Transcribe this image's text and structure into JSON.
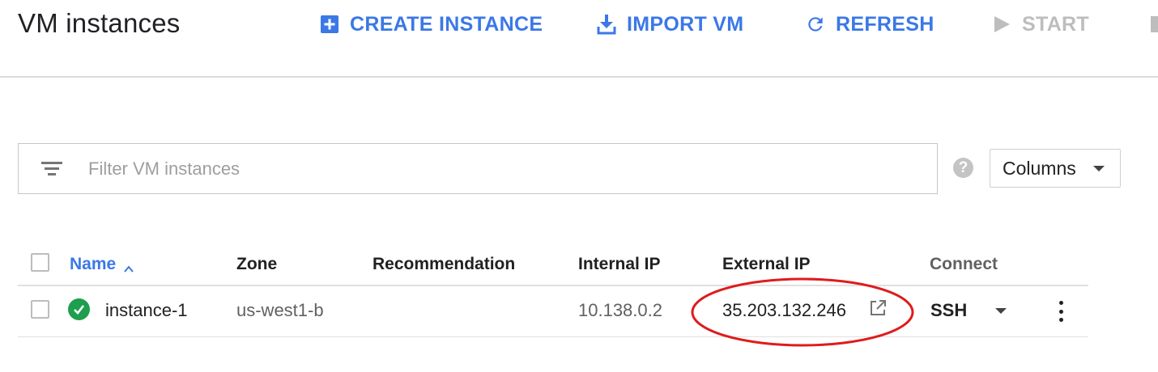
{
  "header": {
    "title": "VM instances",
    "actions": [
      {
        "label": "CREATE INSTANCE",
        "icon": "add-box-icon",
        "enabled": true
      },
      {
        "label": "IMPORT VM",
        "icon": "download-icon",
        "enabled": true
      },
      {
        "label": "REFRESH",
        "icon": "refresh-icon",
        "enabled": true
      },
      {
        "label": "START",
        "icon": "play-icon",
        "enabled": false
      }
    ]
  },
  "filter": {
    "placeholder": "Filter VM instances",
    "value": "",
    "icon": "filter-list-icon"
  },
  "help": {
    "icon": "help-icon",
    "glyph": "?"
  },
  "columns_button": {
    "label": "Columns",
    "icon": "arrow-drop-down-icon"
  },
  "table": {
    "headers": {
      "name": "Name",
      "zone": "Zone",
      "recommendation": "Recommendation",
      "internal_ip": "Internal IP",
      "external_ip": "External IP",
      "connect": "Connect"
    },
    "sort": {
      "column": "Name",
      "direction": "ascending"
    },
    "rows": [
      {
        "status": "running",
        "name": "instance-1",
        "zone": "us-west1-b",
        "recommendation": "",
        "internal_ip": "10.138.0.2",
        "external_ip": "35.203.132.246",
        "connect": "SSH"
      }
    ]
  },
  "colors": {
    "accent_blue": "#3b78e7",
    "status_green": "#1e9e4f",
    "annotation_red": "#e01b1b",
    "disabled_grey": "#bdbdbd"
  }
}
